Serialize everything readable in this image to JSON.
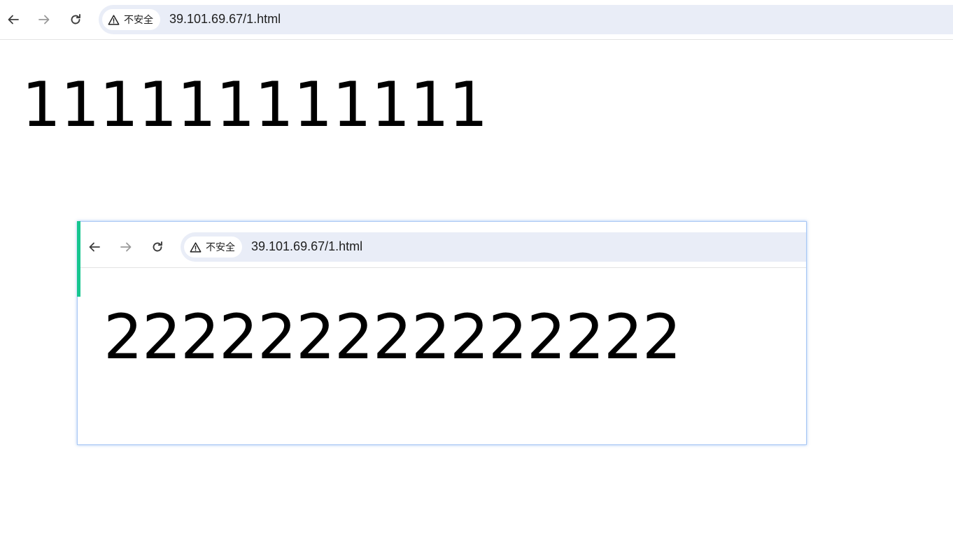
{
  "outer": {
    "toolbar": {
      "back_icon": "arrow-left-icon",
      "forward_icon": "arrow-right-icon",
      "reload_icon": "reload-icon",
      "security_label": "不安全",
      "security_icon": "warning-triangle-icon",
      "url": "39.101.69.67/1.html"
    },
    "content": {
      "text": "111111111111"
    }
  },
  "inner": {
    "toolbar": {
      "back_icon": "arrow-left-icon",
      "forward_icon": "arrow-right-icon",
      "reload_icon": "reload-icon",
      "security_label": "不安全",
      "security_icon": "warning-triangle-icon",
      "url": "39.101.69.67/1.html"
    },
    "content": {
      "text": "222222222222222"
    }
  },
  "colors": {
    "omnibox_bg": "#e9edf7",
    "accent_bar": "#17c68f",
    "frame_border": "#a9c8f5",
    "forward_disabled": "#9a9a9a"
  }
}
